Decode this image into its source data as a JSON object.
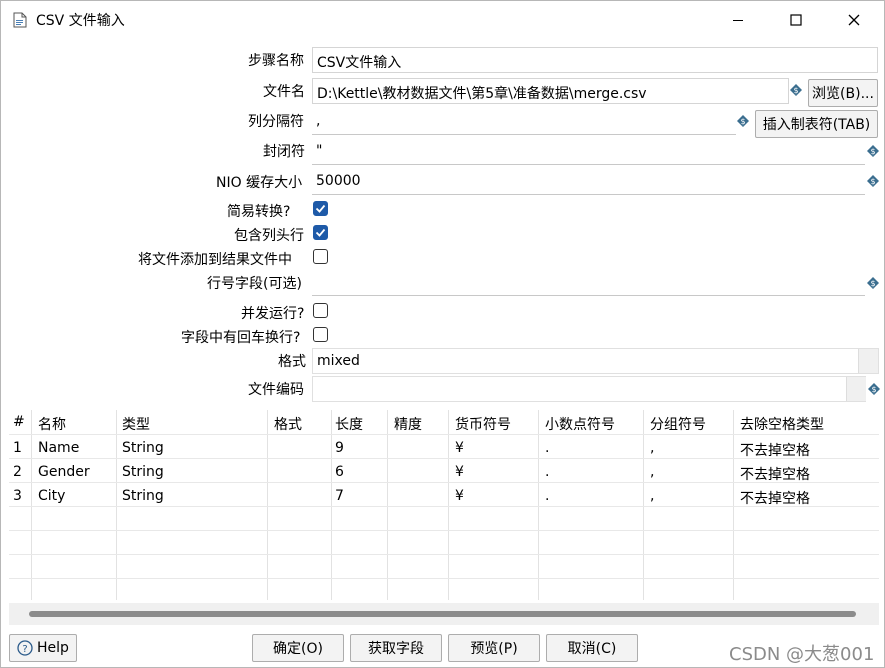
{
  "window": {
    "title": "CSV 文件输入",
    "minimize_glyph": "—",
    "maximize_glyph": "☐",
    "close_glyph": "✕"
  },
  "form": {
    "step_name": {
      "label": "步骤名称",
      "value": "CSV文件输入"
    },
    "file_name": {
      "label": "文件名",
      "value": "D:\\Kettle\\教材数据文件\\第5章\\准备数据\\merge.csv",
      "browse_label": "浏览(B)..."
    },
    "delimiter": {
      "label": "列分隔符",
      "value": ",",
      "insert_tab_label": "插入制表符(TAB)"
    },
    "enclosure": {
      "label": "封闭符",
      "value": "\""
    },
    "nio_buffer": {
      "label": "NIO 缓存大小",
      "value": "50000"
    },
    "lazy_conversion": {
      "label": "简易转换?",
      "checked": true
    },
    "header_row": {
      "label": "包含列头行",
      "checked": true
    },
    "add_to_result": {
      "label": "将文件添加到结果文件中",
      "checked": false
    },
    "rownum_field": {
      "label": "行号字段(可选)",
      "value": ""
    },
    "parallel": {
      "label": "并发运行?",
      "checked": false
    },
    "newline_in_field": {
      "label": "字段中有回车换行?",
      "checked": false
    },
    "format": {
      "label": "格式",
      "value": "mixed"
    },
    "encoding": {
      "label": "文件编码",
      "value": ""
    }
  },
  "table": {
    "columns": [
      "#",
      "名称",
      "类型",
      "格式",
      "长度",
      "精度",
      "货币符号",
      "小数点符号",
      "分组符号",
      "去除空格类型"
    ],
    "rows": [
      [
        "1",
        "Name",
        "String",
        "",
        "9",
        "",
        "¥",
        ".",
        ",",
        "不去掉空格"
      ],
      [
        "2",
        "Gender",
        "String",
        "",
        "6",
        "",
        "¥",
        ".",
        ",",
        "不去掉空格"
      ],
      [
        "3",
        "City",
        "String",
        "",
        "7",
        "",
        "¥",
        ".",
        ",",
        "不去掉空格"
      ]
    ]
  },
  "footer": {
    "help_label": "Help",
    "ok_label": "确定(O)",
    "get_fields_label": "获取字段",
    "preview_label": "预览(P)",
    "cancel_label": "取消(C)"
  },
  "watermark": "CSDN @大葱001",
  "colors": {
    "accent": "#1e5aa8",
    "var_icon": "#3b6e8f"
  }
}
